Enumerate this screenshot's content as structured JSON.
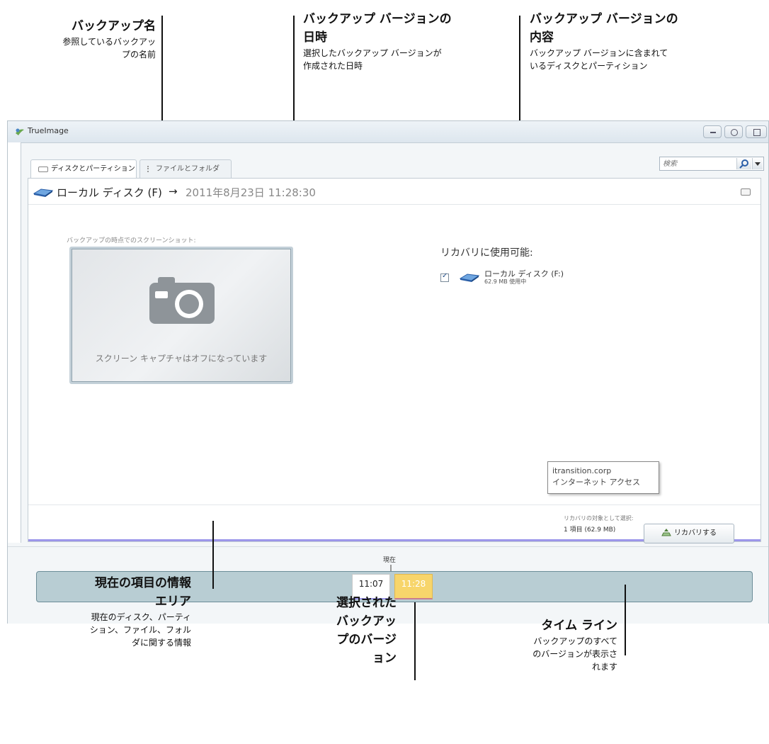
{
  "annotations": {
    "backup_name": {
      "title": "バックアップ名",
      "desc": [
        "参照しているバックアッ",
        "プの名前"
      ]
    },
    "version_date": {
      "title": [
        "バックアップ バージョンの",
        "日時"
      ],
      "desc": [
        "選択したバックアップ バージョンが",
        "作成された日時"
      ]
    },
    "version_content": {
      "title": [
        "バックアップ バージョンの",
        "内容"
      ],
      "desc": [
        "バックアップ バージョンに含まれて",
        "いるディスクとパーティション"
      ]
    },
    "current_info": {
      "title": [
        "現在の項目の情報",
        "エリア"
      ],
      "desc": [
        "現在のディスク、パーティ",
        "ション、ファイル、フォル",
        "ダに関する情報"
      ]
    },
    "selected_version": {
      "title": [
        "選択された",
        "バックアッ",
        "プのバージ",
        "ョン"
      ]
    },
    "timeline": {
      "title": "タイム ライン",
      "desc": [
        "バックアップのすべて",
        "のバージョンが表示さ",
        "れます"
      ]
    }
  },
  "window": {
    "title": "TrueImage",
    "tabs": [
      "ディスクとパーティション",
      "ファイルとフォルダ"
    ],
    "search_placeholder": "検索",
    "header": {
      "drive": "ローカル ディスク (F)",
      "arrow": "→",
      "datetime": "2011年8月23日 11:28:30"
    },
    "screenshot_label": "バックアップの時点でのスクリーンショット:",
    "screenshot_off": "スクリーン キャプチャはオフになっています",
    "recovery": {
      "heading": "リカバリに使用可能:",
      "item_name": "ローカル ディスク (F:)",
      "item_size": "62.9 MB 使用中",
      "checked": true
    },
    "tooltip": {
      "line1": "itransition.corp",
      "line2": "インターネット アクセス"
    },
    "selection": {
      "label": "リカバリの対象として選択:",
      "count": "1 項目 (62.9 MB)"
    },
    "restore_button": "リカバリする"
  },
  "timeline": {
    "now_label": "現在",
    "chips": [
      {
        "time": "11:07",
        "selected": false
      },
      {
        "time": "11:28",
        "selected": true
      }
    ]
  },
  "colors": {
    "selected_chip": "#f7d56b",
    "timeline": "#b8cdd3",
    "accent_bar": "#9c96ea"
  }
}
